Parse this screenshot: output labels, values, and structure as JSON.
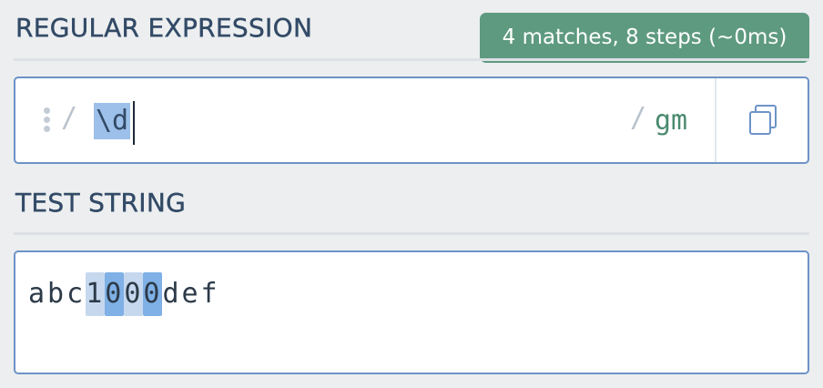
{
  "regex_section": {
    "title": "REGULAR EXPRESSION",
    "match_info": "4 matches, 8 steps (~0ms)",
    "open_delimiter": "/",
    "pattern": "\\d",
    "close_delimiter": "/",
    "flags": "gm",
    "copy_icon": "copy-icon"
  },
  "test_section": {
    "title": "TEST STRING",
    "segments": {
      "prefix": "abc",
      "match_1": "1",
      "match_2": "0",
      "match_3": "0",
      "match_4": "0",
      "suffix": "def"
    }
  },
  "colors": {
    "match_badge": "#5e9a80",
    "input_border": "#6d93c7",
    "selection": "#9cc0ea",
    "match_highlight_light": "#c6d8ee",
    "match_highlight_dark": "#7fb0e6",
    "flags": "#4a8a6e"
  }
}
